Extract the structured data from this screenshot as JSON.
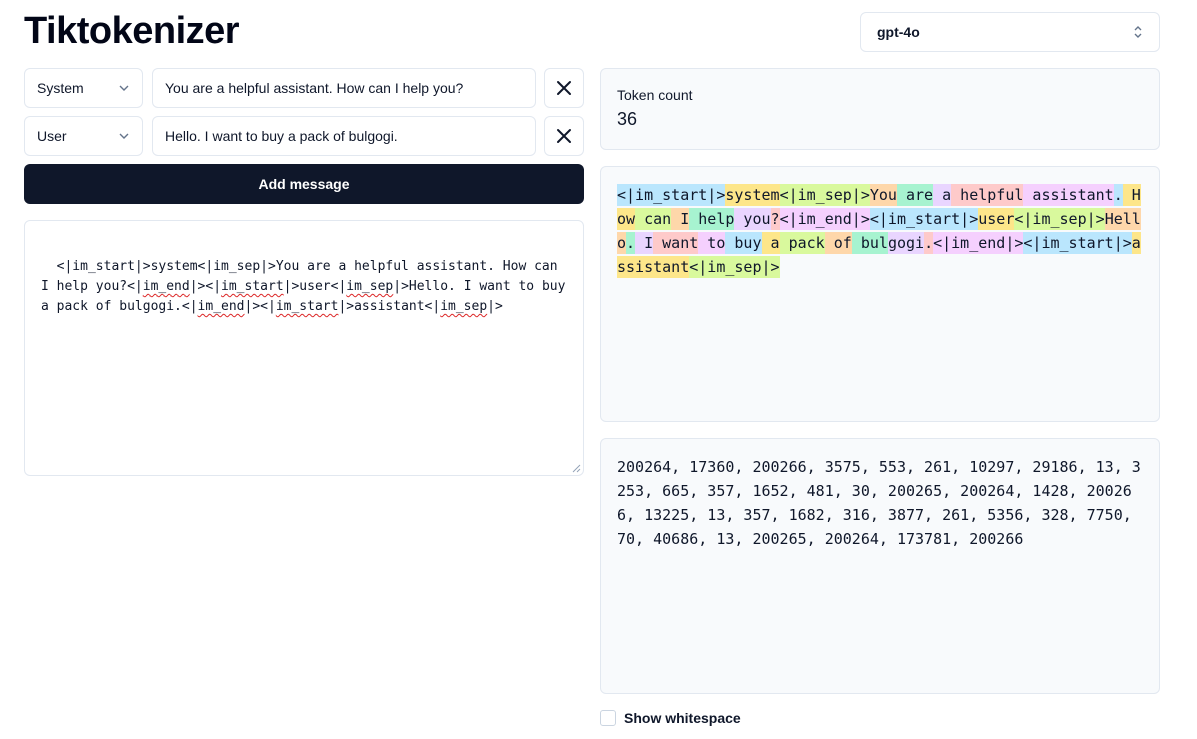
{
  "app": {
    "title": "Tiktokenizer"
  },
  "model_select": {
    "value": "gpt-4o"
  },
  "messages": [
    {
      "role": "System",
      "content": "You are a helpful assistant. How can I help you?"
    },
    {
      "role": "User",
      "content": "Hello. I want to buy a pack of bulgogi."
    }
  ],
  "add_message_label": "Add message",
  "prompt_segments": [
    {
      "text": "<|im_start|>system<|",
      "squiggle": false
    },
    {
      "text": "im_sep",
      "squiggle": false
    },
    {
      "text": "|>You are a helpful assistant. How can I help you?<|",
      "squiggle": false
    },
    {
      "text": "im_end",
      "squiggle": true
    },
    {
      "text": "|><|",
      "squiggle": false
    },
    {
      "text": "im_start",
      "squiggle": true
    },
    {
      "text": "|>user<|",
      "squiggle": false
    },
    {
      "text": "im_sep",
      "squiggle": true
    },
    {
      "text": "|>Hello. I want to buy a pack of bulgogi.<|",
      "squiggle": false
    },
    {
      "text": "im_end",
      "squiggle": true
    },
    {
      "text": "|><|",
      "squiggle": false
    },
    {
      "text": "im_start",
      "squiggle": true
    },
    {
      "text": "|>assistant<|",
      "squiggle": false
    },
    {
      "text": "im_sep",
      "squiggle": true
    },
    {
      "text": "|>",
      "squiggle": false
    }
  ],
  "token_count": {
    "label": "Token count",
    "value": "36"
  },
  "token_palette": [
    "#bae6fd",
    "#fde68a",
    "#d9f99d",
    "#fed7aa",
    "#a7f3d0",
    "#e9d5ff",
    "#fecaca",
    "#f5d0fe"
  ],
  "tokens": [
    "<|im_start|>",
    "system",
    "<|im_sep|>",
    "You",
    " are",
    " a",
    " helpful",
    " assistant",
    ".",
    " How",
    " can",
    " I",
    " help",
    " you",
    "?",
    "<|im_end|>",
    "<|im_start|>",
    "user",
    "<|im_sep|>",
    "Hello",
    ".",
    " I",
    " want",
    " to",
    " buy",
    " a",
    " pack",
    " of",
    " bul",
    "gogi",
    ".",
    "<|im_end|>",
    "<|im_start|>",
    "assistant",
    "<|im_sep|>"
  ],
  "token_ids_text": "200264, 17360, 200266, 3575, 553, 261, 10297, 29186, 13, 3253, 665, 357, 1652, 481, 30, 200265, 200264, 1428, 200266, 13225, 13, 357, 1682, 316, 3877, 261, 5356, 328, 7750, 70, 40686, 13, 200265, 200264, 173781, 200266",
  "show_whitespace": {
    "label": "Show whitespace",
    "checked": false
  }
}
